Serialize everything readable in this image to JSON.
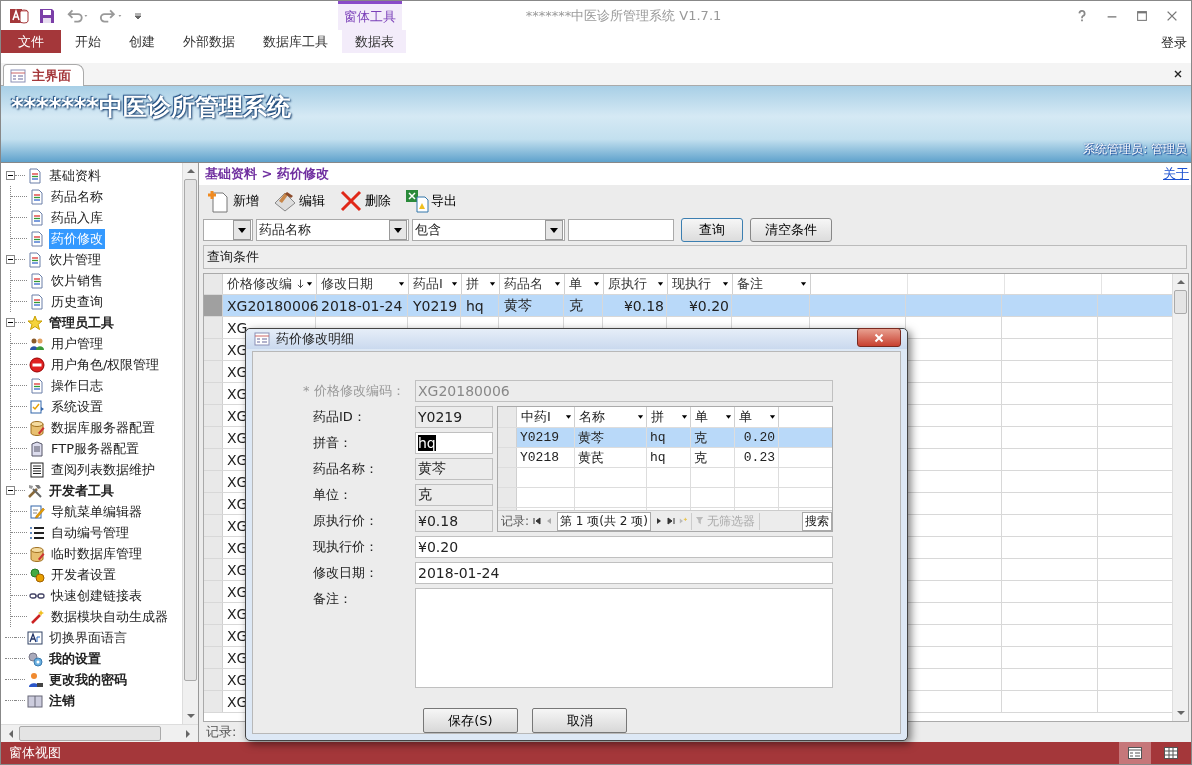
{
  "window": {
    "title": "*******中医诊所管理系统 V1.7.1"
  },
  "ribbon": {
    "contextual_group": "窗体工具",
    "sign_in": "登录",
    "tabs": [
      {
        "label": "文件",
        "kind": "file"
      },
      {
        "label": "开始",
        "kind": "normal"
      },
      {
        "label": "创建",
        "kind": "normal"
      },
      {
        "label": "外部数据",
        "kind": "normal"
      },
      {
        "label": "数据库工具",
        "kind": "normal"
      },
      {
        "label": "数据表",
        "kind": "contextual"
      }
    ]
  },
  "document_tab": {
    "label": "主界面"
  },
  "banner": {
    "title": "*******中医诊所管理系统",
    "user": "系统管理员: 管理员"
  },
  "nav_tree": [
    {
      "label": "基础资料",
      "kind": "doc",
      "bold": false,
      "selected": false,
      "expanded": true,
      "children": [
        {
          "label": "药品名称",
          "kind": "doc",
          "bold": false,
          "selected": false
        },
        {
          "label": "药品入库",
          "kind": "doc",
          "bold": false,
          "selected": false
        },
        {
          "label": "药价修改",
          "kind": "doc",
          "bold": false,
          "selected": true
        }
      ]
    },
    {
      "label": "饮片管理",
      "kind": "doc",
      "bold": false,
      "selected": false,
      "expanded": true,
      "children": [
        {
          "label": "饮片销售",
          "kind": "doc",
          "bold": false,
          "selected": false
        },
        {
          "label": "历史查询",
          "kind": "doc",
          "bold": false,
          "selected": false
        }
      ]
    },
    {
      "label": "管理员工具",
      "kind": "star",
      "bold": true,
      "selected": false,
      "expanded": true,
      "children": [
        {
          "label": "用户管理",
          "kind": "users",
          "bold": false,
          "selected": false
        },
        {
          "label": "用户角色/权限管理",
          "kind": "no-entry",
          "bold": false,
          "selected": false
        },
        {
          "label": "操作日志",
          "kind": "doc",
          "bold": false,
          "selected": false
        },
        {
          "label": "系统设置",
          "kind": "settings",
          "bold": false,
          "selected": false
        },
        {
          "label": "数据库服务器配置",
          "kind": "database",
          "bold": false,
          "selected": false
        },
        {
          "label": "FTP服务器配置",
          "kind": "server",
          "bold": false,
          "selected": false
        },
        {
          "label": "查阅列表数据维护",
          "kind": "list",
          "bold": false,
          "selected": false
        }
      ]
    },
    {
      "label": "开发者工具",
      "kind": "tools",
      "bold": true,
      "selected": false,
      "expanded": true,
      "children": [
        {
          "label": "导航菜单编辑器",
          "kind": "edit",
          "bold": false,
          "selected": false
        },
        {
          "label": "自动编号管理",
          "kind": "numbered",
          "bold": false,
          "selected": false
        },
        {
          "label": "临时数据库管理",
          "kind": "database",
          "bold": false,
          "selected": false
        },
        {
          "label": "开发者设置",
          "kind": "gears",
          "bold": false,
          "selected": false
        },
        {
          "label": "快速创建链接表",
          "kind": "link",
          "bold": false,
          "selected": false
        },
        {
          "label": "数据模块自动生成器",
          "kind": "wand",
          "bold": false,
          "selected": false
        }
      ]
    },
    {
      "label": "切换界面语言",
      "kind": "font",
      "bold": false,
      "selected": false
    },
    {
      "label": "我的设置",
      "kind": "gear",
      "bold": true,
      "selected": false
    },
    {
      "label": "更改我的密码",
      "kind": "user",
      "bold": true,
      "selected": false
    },
    {
      "label": "注销",
      "kind": "window",
      "bold": true,
      "selected": false
    }
  ],
  "breadcrumb": "基础资料 > 药价修改",
  "about_link": "关于",
  "toolbar": [
    {
      "label": "新增",
      "kind": "new"
    },
    {
      "label": "编辑",
      "kind": "edit"
    },
    {
      "label": "删除",
      "kind": "delete"
    },
    {
      "label": "导出",
      "kind": "export"
    }
  ],
  "filter": {
    "field": "药品名称",
    "operator": "包含",
    "search_button": "查询",
    "clear_button": "清空条件",
    "condition_label": "查询条件"
  },
  "grid": {
    "record_label": "记录:",
    "columns": [
      {
        "label": "价格修改编",
        "kind": "text",
        "sorted": true
      },
      {
        "label": "修改日期",
        "kind": "text",
        "sorted": false
      },
      {
        "label": "药品I",
        "kind": "text",
        "sorted": false
      },
      {
        "label": "拼",
        "kind": "text",
        "sorted": false
      },
      {
        "label": "药品名",
        "kind": "text",
        "sorted": false
      },
      {
        "label": "单",
        "kind": "text",
        "sorted": false
      },
      {
        "label": "原执行",
        "kind": "currency",
        "sorted": false
      },
      {
        "label": "现执行",
        "kind": "currency",
        "sorted": false
      },
      {
        "label": "备注",
        "kind": "text",
        "sorted": false
      }
    ],
    "rows": [
      {
        "selected": true,
        "cells": [
          "XG20180006",
          "2018-01-24",
          "Y0219",
          "hq",
          "黄芩",
          "克",
          "¥0.18",
          "¥0.20"
        ]
      },
      {
        "selected": false,
        "cells": [
          "XG"
        ]
      },
      {
        "selected": false,
        "cells": [
          "XG"
        ]
      },
      {
        "selected": false,
        "cells": [
          "XG"
        ]
      },
      {
        "selected": false,
        "cells": [
          "XG"
        ]
      },
      {
        "selected": false,
        "cells": [
          "XG"
        ]
      },
      {
        "selected": false,
        "cells": [
          "XG"
        ]
      },
      {
        "selected": false,
        "cells": [
          "XG"
        ]
      },
      {
        "selected": false,
        "cells": [
          "XG"
        ]
      },
      {
        "selected": false,
        "cells": [
          "XG"
        ]
      },
      {
        "selected": false,
        "cells": [
          "XG"
        ]
      },
      {
        "selected": false,
        "cells": [
          "XG"
        ]
      },
      {
        "selected": false,
        "cells": [
          "XG"
        ]
      },
      {
        "selected": false,
        "cells": [
          "XG"
        ]
      },
      {
        "selected": false,
        "cells": [
          "XG"
        ]
      },
      {
        "selected": false,
        "cells": [
          "XG"
        ]
      },
      {
        "selected": false,
        "cells": [
          "XG"
        ]
      },
      {
        "selected": false,
        "cells": [
          "XG"
        ]
      },
      {
        "selected": false,
        "cells": [
          "XG"
        ]
      }
    ]
  },
  "dialog": {
    "title": "药价修改明细",
    "fields": [
      {
        "label": "* 价格修改编码：",
        "value": "XG20180006",
        "kind": "disabled"
      },
      {
        "label": "药品ID：",
        "value": "Y0219",
        "kind": "locked"
      },
      {
        "label": "拼音：",
        "value": "hq",
        "kind": "focused"
      },
      {
        "label": "药品名称：",
        "value": "黄芩",
        "kind": "locked"
      },
      {
        "label": "单位：",
        "value": "克",
        "kind": "locked"
      },
      {
        "label": "原执行价：",
        "value": "¥0.18",
        "kind": "locked"
      },
      {
        "label": "现执行价：",
        "value": "¥0.20",
        "kind": "input"
      },
      {
        "label": "修改日期：",
        "value": "2018-01-24",
        "kind": "input"
      },
      {
        "label": "备注：",
        "kind": "memo"
      }
    ],
    "lookup": {
      "columns": [
        "中药I",
        "名称",
        "拼",
        "单",
        "单"
      ],
      "rows": [
        {
          "selected": true,
          "cells": [
            "Y0219",
            "黄芩",
            "hq",
            "克",
            "0.20"
          ]
        },
        {
          "selected": false,
          "cells": [
            "Y0218",
            "黄芪",
            "hq",
            "克",
            "0.23"
          ]
        }
      ],
      "record_label": "记录:",
      "position": "第 1 项(共 2 项)",
      "filter": "无筛选器",
      "search": "搜索"
    },
    "buttons": [
      "保存(S)",
      "取消"
    ]
  },
  "status_bar": {
    "label": "窗体视图",
    "views": [
      {
        "kind": "form",
        "selected": true
      },
      {
        "kind": "datasheet",
        "selected": false
      }
    ]
  }
}
